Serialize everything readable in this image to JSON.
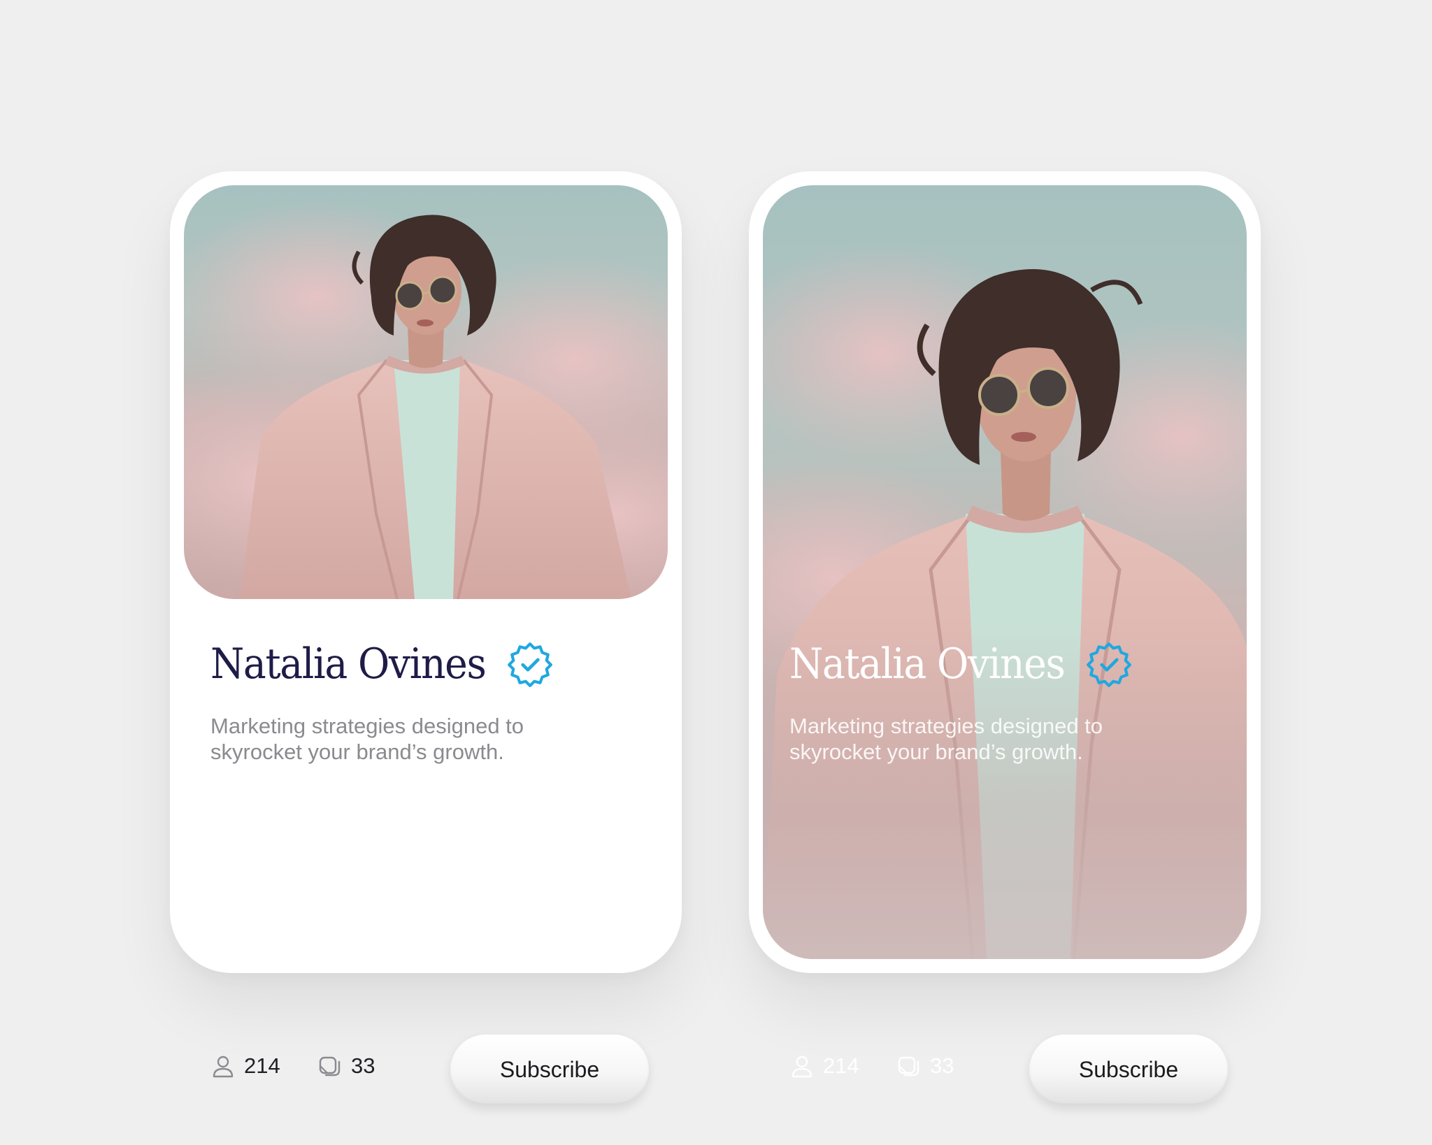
{
  "profile": {
    "name": "Natalia Ovines",
    "bio": "Marketing strategies designed to skyrocket your brand’s growth.",
    "followers": "214",
    "posts": "33",
    "subscribe_label": "Subscribe"
  },
  "icons": {
    "verified": "verified-badge-icon",
    "followers": "user-icon",
    "posts": "posts-stack-icon"
  },
  "colors": {
    "accent": "#1fa8e0",
    "name_text": "#1e1c47",
    "bio_text": "#8a8a8f",
    "background": "#efefef"
  }
}
